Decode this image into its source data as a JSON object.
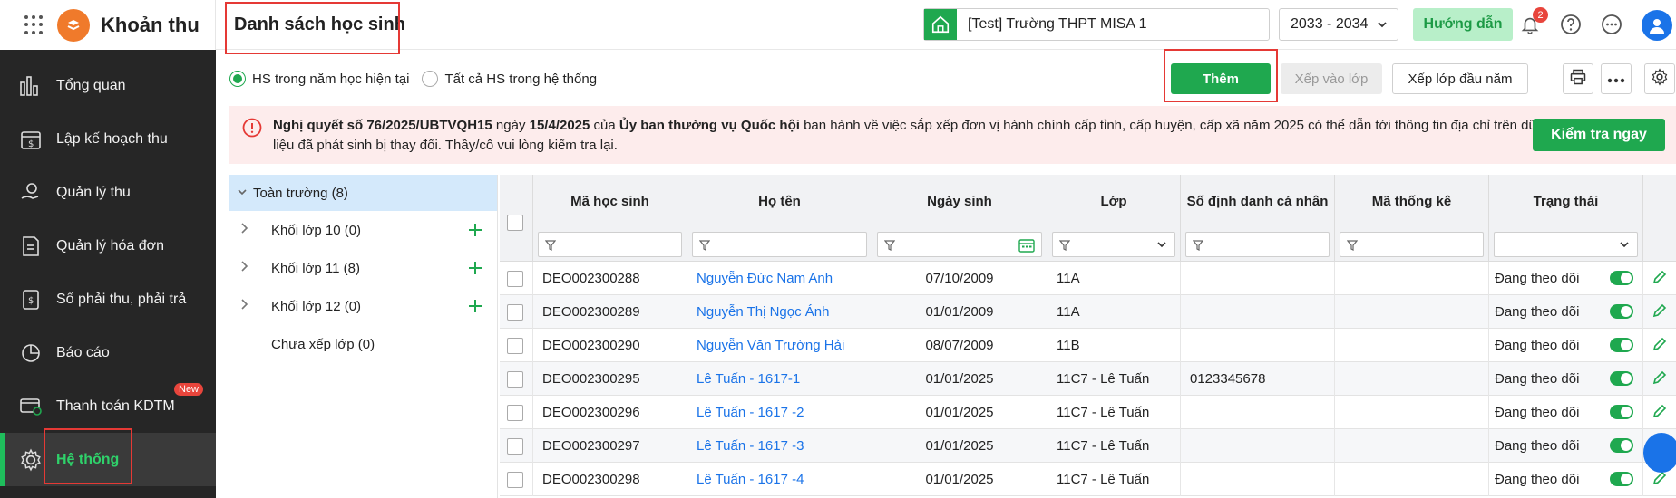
{
  "sidebar": {
    "app_title": "Khoản thu",
    "items": [
      {
        "label": "Tổng quan",
        "icon": "bar-chart-icon"
      },
      {
        "label": "Lập kế hoạch thu",
        "icon": "calendar-money-icon"
      },
      {
        "label": "Quản lý thu",
        "icon": "hand-coin-icon"
      },
      {
        "label": "Quản lý hóa đơn",
        "icon": "invoice-icon"
      },
      {
        "label": "Sổ phải thu, phải trả",
        "icon": "ledger-icon"
      },
      {
        "label": "Báo cáo",
        "icon": "pie-chart-icon"
      },
      {
        "label": "Thanh toán KDTM",
        "icon": "card-payment-icon",
        "badge": "New"
      },
      {
        "label": "Hệ thống",
        "icon": "gear-icon",
        "active": true
      }
    ]
  },
  "header": {
    "page_title": "Danh sách học sinh",
    "school": "[Test] Trường THPT MISA 1",
    "year": "2033 - 2034",
    "guide_label": "Hướng dẫn",
    "notification_count": "2"
  },
  "filters": {
    "radio_current": "HS trong năm học hiện tại",
    "radio_all": "Tất cả HS trong hệ thống"
  },
  "toolbar": {
    "add_label": "Thêm",
    "assign_label": "Xếp vào lớp",
    "start_label": "Xếp lớp đầu năm"
  },
  "notice": {
    "part1": "Nghị quyết số 76/2025/UBTVQH15",
    "part2": " ngày ",
    "part3": "15/4/2025",
    "part4": " của ",
    "part5": "Ủy ban thường vụ Quốc hội",
    "part6": " ban hành về việc sắp xếp đơn vị hành chính cấp tỉnh, cấp huyện, cấp xã năm 2025 có thể dẫn tới thông tin địa chỉ trên dữ liệu đã phát sinh bị thay đổi. Thầy/cô vui lòng kiểm tra lại.",
    "check_label": "Kiểm tra ngay"
  },
  "tree": {
    "root": "Toàn trường (8)",
    "items": [
      {
        "label": "Khối lớp 10  (0)"
      },
      {
        "label": "Khối lớp 11  (8)"
      },
      {
        "label": "Khối lớp 12  (0)"
      },
      {
        "label": "Chưa xếp lớp  (0)"
      }
    ]
  },
  "table": {
    "columns": [
      "Mã học sinh",
      "Họ tên",
      "Ngày sinh",
      "Lớp",
      "Số định danh cá nhân",
      "Mã thống kê",
      "Trạng thái"
    ],
    "rows": [
      {
        "code": "DEO002300288",
        "name": "Nguyễn Đức Nam Anh",
        "dob": "07/10/2009",
        "cls": "11A",
        "pid": "",
        "stat": "",
        "status": "Đang theo dõi"
      },
      {
        "code": "DEO002300289",
        "name": "Nguyễn Thị Ngọc Ánh",
        "dob": "01/01/2009",
        "cls": "11A",
        "pid": "",
        "stat": "",
        "status": "Đang theo dõi"
      },
      {
        "code": "DEO002300290",
        "name": "Nguyễn Văn Trường Hải",
        "dob": "08/07/2009",
        "cls": "11B",
        "pid": "",
        "stat": "",
        "status": "Đang theo dõi"
      },
      {
        "code": "DEO002300295",
        "name": "Lê Tuấn - 1617-1",
        "dob": "01/01/2025",
        "cls": "11C7 - Lê Tuấn",
        "pid": "0123345678",
        "stat": "",
        "status": "Đang theo dõi"
      },
      {
        "code": "DEO002300296",
        "name": "Lê Tuấn - 1617 -2",
        "dob": "01/01/2025",
        "cls": "11C7 - Lê Tuấn",
        "pid": "",
        "stat": "",
        "status": "Đang theo dõi"
      },
      {
        "code": "DEO002300297",
        "name": "Lê Tuấn - 1617 -3",
        "dob": "01/01/2025",
        "cls": "11C7 - Lê Tuấn",
        "pid": "",
        "stat": "",
        "status": "Đang theo dõi"
      },
      {
        "code": "DEO002300298",
        "name": "Lê Tuấn - 1617 -4",
        "dob": "01/01/2025",
        "cls": "11C7 - Lê Tuấn",
        "pid": "",
        "stat": "",
        "status": "Đang theo dõi"
      }
    ]
  },
  "colors": {
    "accent": "#1fa84f",
    "link": "#1a73e8",
    "notice_bg": "#fdecec",
    "highlight": "#e53935"
  }
}
